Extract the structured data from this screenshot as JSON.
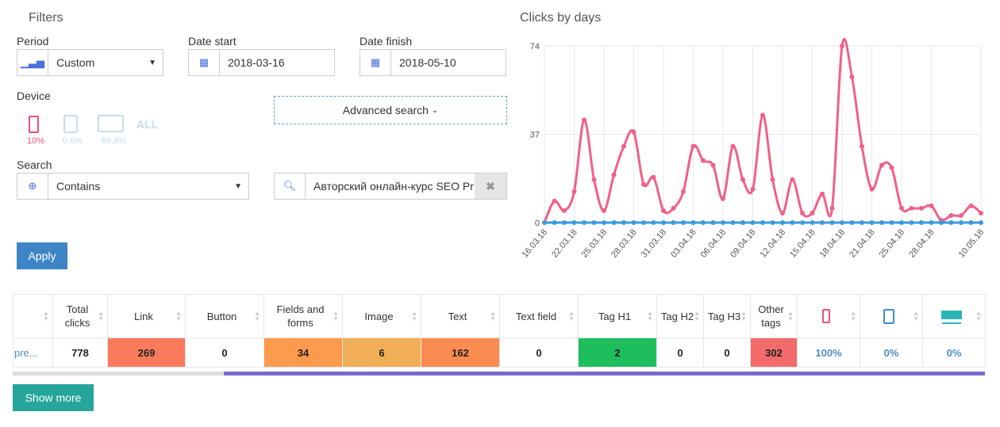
{
  "filters": {
    "title": "Filters",
    "period_label": "Period",
    "period_value": "Custom",
    "date_start_label": "Date start",
    "date_start": "2018-03-16",
    "date_finish_label": "Date finish",
    "date_finish": "2018-05-10",
    "device_label": "Device",
    "devices": [
      {
        "icon": "mobile-icon",
        "pct": "10%",
        "color": "#e8537a"
      },
      {
        "icon": "tablet-icon",
        "pct": "0.6%",
        "color": "#c5dcec"
      },
      {
        "icon": "desktop-icon",
        "pct": "89.4%",
        "color": "#c5dcec"
      }
    ],
    "device_all": "ALL",
    "advanced_search": "Advanced search",
    "search_label": "Search",
    "search_mode": "Contains",
    "search_value": "Авторский онлайн-курс SEO Pr",
    "apply": "Apply"
  },
  "chart_data": {
    "type": "line",
    "title": "Clicks by days",
    "yticks": [
      0,
      37,
      74
    ],
    "ylim": [
      0,
      74
    ],
    "grid": true,
    "xtick_labels": [
      {
        "i": 0,
        "label": "16.03.18"
      },
      {
        "i": 3,
        "label": "22.03.18"
      },
      {
        "i": 6,
        "label": "25.03.18"
      },
      {
        "i": 9,
        "label": "28.03.18"
      },
      {
        "i": 12,
        "label": "31.03.18"
      },
      {
        "i": 15,
        "label": "03.04.18"
      },
      {
        "i": 18,
        "label": "06.04.18"
      },
      {
        "i": 21,
        "label": "09.04.18"
      },
      {
        "i": 24,
        "label": "12.04.18"
      },
      {
        "i": 27,
        "label": "15.04.18"
      },
      {
        "i": 30,
        "label": "18.04.18"
      },
      {
        "i": 33,
        "label": "21.04.18"
      },
      {
        "i": 36,
        "label": "25.04.18"
      },
      {
        "i": 39,
        "label": "28.04.18"
      },
      {
        "i": 44,
        "label": "10.05.18"
      }
    ],
    "series": [
      {
        "color": "#f06088",
        "values": [
          0,
          9,
          5,
          13,
          43,
          18,
          5,
          20,
          32,
          38,
          16,
          19,
          5,
          6,
          13,
          32,
          26,
          24,
          10,
          32,
          18,
          14,
          45,
          18,
          4,
          18,
          4,
          4,
          12,
          6,
          74,
          61,
          32,
          14,
          24,
          23,
          6,
          6,
          6,
          7,
          1,
          3,
          3,
          7,
          4
        ]
      },
      {
        "color": "#3a9bdc",
        "values": [
          0,
          0,
          0,
          0,
          0,
          0,
          0,
          0,
          0,
          0,
          0,
          0,
          0,
          0,
          0,
          0,
          0,
          0,
          0,
          0,
          0,
          0,
          0,
          0,
          0,
          0,
          0,
          0,
          0,
          0,
          0,
          0,
          0,
          0,
          0,
          0,
          0,
          0,
          0,
          0,
          0,
          0,
          0,
          0,
          0
        ]
      }
    ]
  },
  "table": {
    "headers": [
      "",
      "Total clicks",
      "Link",
      "Button",
      "Fields and forms",
      "Image",
      "Text",
      "Text field",
      "Tag H1",
      "Tag H2",
      "Tag H3",
      "Other tags",
      "mobile-icon",
      "tablet-icon",
      "desktop-icon"
    ],
    "row": [
      "pre...",
      "778",
      "269",
      "0",
      "34",
      "6",
      "162",
      "0",
      "2",
      "0",
      "0",
      "302",
      "100%",
      "0%",
      "0%"
    ],
    "cell_colors": [
      "",
      "",
      "#fa7b5c",
      "",
      "#fd9a4b",
      "#f0ae57",
      "#fc8b52",
      "",
      "#1ebe5d",
      "",
      "",
      "#f26a6a",
      "",
      "",
      ""
    ],
    "icon_colors": {
      "mobile": "#e8537a",
      "tablet": "#3b8fd6",
      "desktop": "#2bb5b5"
    }
  },
  "show_more": "Show more"
}
